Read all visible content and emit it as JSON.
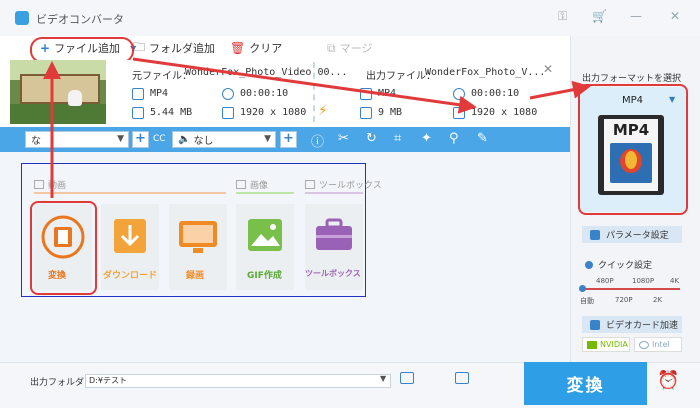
{
  "app": {
    "title": "ビデオコンバータ"
  },
  "toolbar": {
    "add_file": "ファイル追加",
    "add_folder": "フォルダ追加",
    "clear": "クリア",
    "merge": "マージ"
  },
  "file": {
    "source_label": "元ファイル：",
    "source_name": "WonderFox_Photo_Video 00...",
    "output_label": "出力ファイル：",
    "output_name": "WonderFox_Photo_V...",
    "src_format": "MP4",
    "src_duration": "00:00:10",
    "src_size": "5.44 MB",
    "src_resolution": "1920 x 1080",
    "out_format": "MP4",
    "out_duration": "00:00:10",
    "out_size": "9 MB",
    "out_resolution": "1920 x 1080"
  },
  "editbar": {
    "subtitle_select": "な",
    "audio_select": "なし"
  },
  "sections": {
    "video": "動画",
    "image": "画像",
    "toolbox": "ツールボックス"
  },
  "tiles": [
    {
      "label": "変換",
      "color": "#e9771f"
    },
    {
      "label": "ダウンロード",
      "color": "#f2a33a"
    },
    {
      "label": "録画",
      "color": "#f08a24"
    },
    {
      "label": "GIF作成",
      "color": "#78c04a"
    },
    {
      "label": "ツールボックス",
      "color": "#9a62b6"
    }
  ],
  "right_panel": {
    "output_format_title": "出力フォーマットを選択",
    "format": "MP4",
    "format_icon_label": "MP4",
    "params_button": "パラメータ設定",
    "quick_settings": "クイック設定",
    "quality_top": [
      "480P",
      "1080P",
      "4K"
    ],
    "quality_bottom": [
      "自動",
      "720P",
      "2K"
    ],
    "gpu_accel": "ビデオカード加速",
    "nvidia": "NVIDIA",
    "intel": "Intel"
  },
  "bottom": {
    "output_folder_label": "出力フォルダ：",
    "output_folder_path": "D:¥テスト",
    "convert_button": "変換"
  },
  "colors": {
    "accent": "#2e9ee6",
    "bar": "#4aa6e6",
    "highlight_red": "#e03a3a",
    "frame_blue": "#2233c4"
  }
}
